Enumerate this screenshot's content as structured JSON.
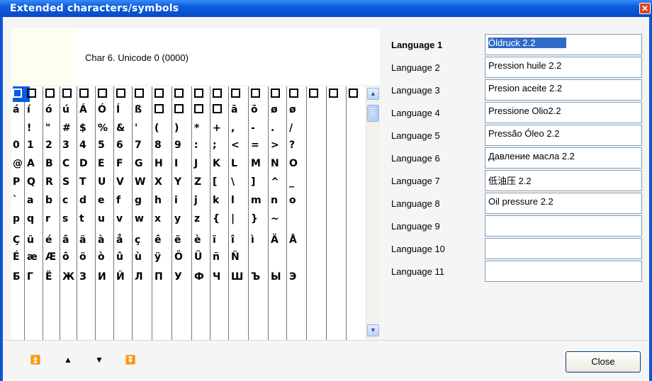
{
  "window": {
    "title": "Extended characters/symbols",
    "close_glyph": "✕"
  },
  "preview": {
    "text": "Char 6. Unicode 0 (0000)"
  },
  "grid": {
    "rows": [
      [
        "□",
        "□",
        "□",
        "□",
        "□",
        "□",
        "□",
        "□",
        "□",
        "□",
        "□",
        "□",
        "□",
        "□",
        "□",
        "□",
        "□",
        "□",
        "□",
        "□"
      ],
      [
        "á",
        "í",
        "ó",
        "ú",
        "Á",
        "Ó",
        "Í",
        "ß",
        "□",
        "□",
        "□",
        "□",
        "ā",
        "ō",
        "ø",
        "ø"
      ],
      [
        "",
        "!",
        "\"",
        "#",
        "$",
        "%",
        "&",
        "'",
        "(",
        ")",
        "*",
        "+",
        ",",
        "-",
        ".",
        "/"
      ],
      [
        "0",
        "1",
        "2",
        "3",
        "4",
        "5",
        "6",
        "7",
        "8",
        "9",
        ":",
        ";",
        "<",
        "=",
        ">",
        "?"
      ],
      [
        "@",
        "A",
        "B",
        "C",
        "D",
        "E",
        "F",
        "G",
        "H",
        "I",
        "J",
        "K",
        "L",
        "M",
        "N",
        "O"
      ],
      [
        "P",
        "Q",
        "R",
        "S",
        "T",
        "U",
        "V",
        "W",
        "X",
        "Y",
        "Z",
        "[",
        "\\",
        "]",
        "^",
        "_"
      ],
      [
        "`",
        "a",
        "b",
        "c",
        "d",
        "e",
        "f",
        "g",
        "h",
        "i",
        "j",
        "k",
        "l",
        "m",
        "n",
        "o"
      ],
      [
        "p",
        "q",
        "r",
        "s",
        "t",
        "u",
        "v",
        "w",
        "x",
        "y",
        "z",
        "{",
        "|",
        "}",
        "~",
        ""
      ],
      [
        "Ç",
        "ü",
        "é",
        "â",
        "ä",
        "à",
        "å",
        "ç",
        "ê",
        "ë",
        "è",
        "ï",
        "î",
        "ì",
        "Ä",
        "Å"
      ],
      [
        "É",
        "æ",
        "Æ",
        "ô",
        "ö",
        "ò",
        "û",
        "ù",
        "ÿ",
        "Ö",
        "Ü",
        "ñ",
        "Ñ",
        "",
        "",
        ""
      ],
      [
        "Б",
        "Г",
        "Ё",
        "Ж",
        "З",
        "И",
        "Й",
        "Л",
        "П",
        "У",
        "Ф",
        "Ч",
        "Ш",
        "Ъ",
        "Ы",
        "Э"
      ]
    ]
  },
  "scrollbar": {
    "up_glyph": "▲",
    "down_glyph": "▼"
  },
  "languages": [
    {
      "label": "Language 1",
      "value": "Öldruck 2.2"
    },
    {
      "label": "Language 2",
      "value": "Pression huile 2.2"
    },
    {
      "label": "Language 3",
      "value": "Presion aceite 2.2"
    },
    {
      "label": "Language 4",
      "value": "Pressione Olio2.2"
    },
    {
      "label": "Language 5",
      "value": "Pressão Óleo 2.2"
    },
    {
      "label": "Language 6",
      "value": "Давление масла 2.2"
    },
    {
      "label": "Language 7",
      "value": "低油压 2.2"
    },
    {
      "label": "Language 8",
      "value": "Oil pressure 2.2"
    },
    {
      "label": "Language 9",
      "value": ""
    },
    {
      "label": "Language 10",
      "value": ""
    },
    {
      "label": "Language 11",
      "value": ""
    }
  ],
  "nav": {
    "first": "⏫",
    "prev": "▲",
    "next": "▼",
    "last": "⏬"
  },
  "close_button": {
    "label": "Close"
  }
}
